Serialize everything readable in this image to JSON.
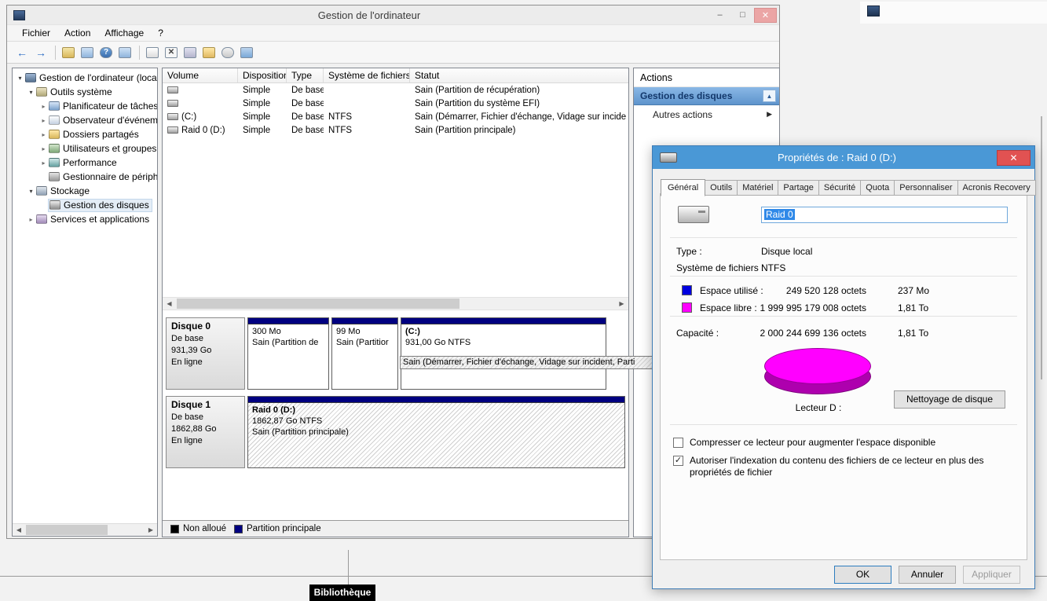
{
  "icons": {
    "minimize": "–",
    "maximize": "□",
    "close": "✕",
    "back": "←",
    "forward": "→",
    "help": "?",
    "delete": "✕",
    "tree_collapsed": "▸",
    "tree_expanded": "▾",
    "chevron_up": "▲",
    "chevron_right": "▶",
    "scroll_left": "◀",
    "scroll_right": "▶",
    "check": "✓"
  },
  "desktop": {
    "taskbar_tooltip": "Bibliothèque"
  },
  "window": {
    "title": "Gestion de l'ordinateur",
    "menu": [
      "Fichier",
      "Action",
      "Affichage",
      "?"
    ],
    "tree": {
      "items": [
        {
          "label": "Gestion de l'ordinateur (local)",
          "state": "expanded"
        },
        {
          "label": "Outils système",
          "state": "expanded"
        },
        {
          "label": "Planificateur de tâches",
          "state": "collapsed"
        },
        {
          "label": "Observateur d'événeme",
          "state": "collapsed"
        },
        {
          "label": "Dossiers partagés",
          "state": "collapsed"
        },
        {
          "label": "Utilisateurs et groupes l",
          "state": "collapsed"
        },
        {
          "label": "Performance",
          "state": "collapsed"
        },
        {
          "label": "Gestionnaire de périphé",
          "state": "leaf"
        },
        {
          "label": "Stockage",
          "state": "expanded"
        },
        {
          "label": "Gestion des disques",
          "state": "leaf",
          "selected": true
        },
        {
          "label": "Services et applications",
          "state": "collapsed"
        }
      ]
    },
    "volumes": {
      "columns": [
        "Volume",
        "Disposition",
        "Type",
        "Système de fichiers",
        "Statut"
      ],
      "rows": [
        {
          "volume": "",
          "disposition": "Simple",
          "type": "De base",
          "fs": "",
          "statut": "Sain (Partition de récupération)"
        },
        {
          "volume": "",
          "disposition": "Simple",
          "type": "De base",
          "fs": "",
          "statut": "Sain (Partition du système EFI)"
        },
        {
          "volume": "(C:)",
          "disposition": "Simple",
          "type": "De base",
          "fs": "NTFS",
          "statut": "Sain (Démarrer, Fichier d'échange, Vidage sur incide"
        },
        {
          "volume": "Raid 0 (D:)",
          "disposition": "Simple",
          "type": "De base",
          "fs": "NTFS",
          "statut": "Sain (Partition principale)"
        }
      ]
    },
    "disks": [
      {
        "name": "Disque 0",
        "type": "De base",
        "size": "931,39 Go",
        "status": "En ligne",
        "partitions": [
          {
            "label": "",
            "size": "300 Mo",
            "status": "Sain (Partition de"
          },
          {
            "label": "",
            "size": "99 Mo",
            "status": "Sain (Partitior"
          },
          {
            "label": "(C:)",
            "size": "931,00 Go NTFS",
            "status": "Sain (Démarrer, Fichier d'échange, Vidage sur incident, Parti"
          }
        ]
      },
      {
        "name": "Disque 1",
        "type": "De base",
        "size": "1862,88 Go",
        "status": "En ligne",
        "partitions": [
          {
            "label": "Raid 0  (D:)",
            "size": "1862,87 Go NTFS",
            "status": "Sain (Partition principale)"
          }
        ]
      }
    ],
    "legend": [
      {
        "label": "Non alloué",
        "color": "#000000"
      },
      {
        "label": "Partition principale",
        "color": "#000080"
      }
    ],
    "actions": {
      "header": "Actions",
      "group": "Gestion des disques",
      "more": "Autres actions"
    }
  },
  "dialog": {
    "title": "Propriétés de : Raid 0 (D:)",
    "tabs": [
      "Général",
      "Outils",
      "Matériel",
      "Partage",
      "Sécurité",
      "Quota",
      "Personnaliser",
      "Acronis Recovery"
    ],
    "active_tab": "Général",
    "name_value": "Raid 0",
    "type_label": "Type :",
    "type_value": "Disque local",
    "fs_label": "Système de fichiers :",
    "fs_value": "NTFS",
    "used_label": "Espace utilisé :",
    "used_bytes": "249 520 128 octets",
    "used_human": "237 Mo",
    "used_color": "#0000e0",
    "free_label": "Espace libre :",
    "free_bytes": "1 999 995 179 008 octets",
    "free_human": "1,81 To",
    "free_color": "#ff00ff",
    "capacity_label": "Capacité :",
    "capacity_bytes": "2 000 244 699 136 octets",
    "capacity_human": "1,81 To",
    "drive_label": "Lecteur D :",
    "cleanup_button": "Nettoyage de disque",
    "compress_label": "Compresser ce lecteur pour augmenter l'espace disponible",
    "compress_checked": false,
    "index_label": "Autoriser l'indexation du contenu des fichiers de ce lecteur en plus des propriétés de fichier",
    "index_checked": true,
    "ok": "OK",
    "cancel": "Annuler",
    "apply": "Appliquer"
  }
}
